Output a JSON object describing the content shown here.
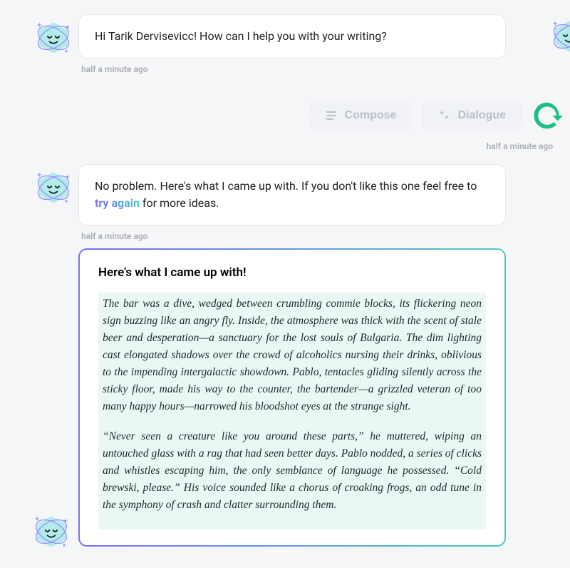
{
  "messages": {
    "greeting": {
      "text": "Hi Tarik Dervisevicc! How can I help you with your writing?",
      "timestamp": "half a minute ago"
    },
    "actions": {
      "compose_label": "Compose",
      "dialogue_label": "Dialogue",
      "timestamp": "half a minute ago"
    },
    "assistant_reply": {
      "prefix": "No problem. Here's what I came up with. If you don't like this one feel free to ",
      "try_again": "try again",
      "suffix": " for more ideas.",
      "timestamp": "half a minute ago"
    },
    "output": {
      "heading": "Here's what I came up with!",
      "paragraphs": [
        "The bar was a dive, wedged between crumbling commie blocks, its flickering neon sign buzzing like an angry fly. Inside, the atmosphere was thick with the scent of stale beer and desperation—a sanctuary for the lost souls of Bulgaria. The dim lighting cast elongated shadows over the crowd of alcoholics nursing their drinks, oblivious to the impending intergalactic showdown. Pablo, tentacles gliding silently across the sticky floor, made his way to the counter, the bartender—a grizzled veteran of too many happy hours—narrowed his bloodshot eyes at the strange sight.",
        "“Never seen a creature like you around these parts,” he muttered, wiping an untouched glass with a rag that had seen better days. Pablo nodded, a series of clicks and whistles escaping him, the only semblance of language he possessed. “Cold brewski, please.” His voice sounded like a chorus of croaking frogs, an odd tune in the symphony of crash and clatter surrounding them."
      ]
    }
  },
  "icons": {
    "compose": "lines-icon",
    "dialogue": "sparkle-icon",
    "assistant_avatar": "star-avatar",
    "brand_badge": "grammarly-badge"
  }
}
